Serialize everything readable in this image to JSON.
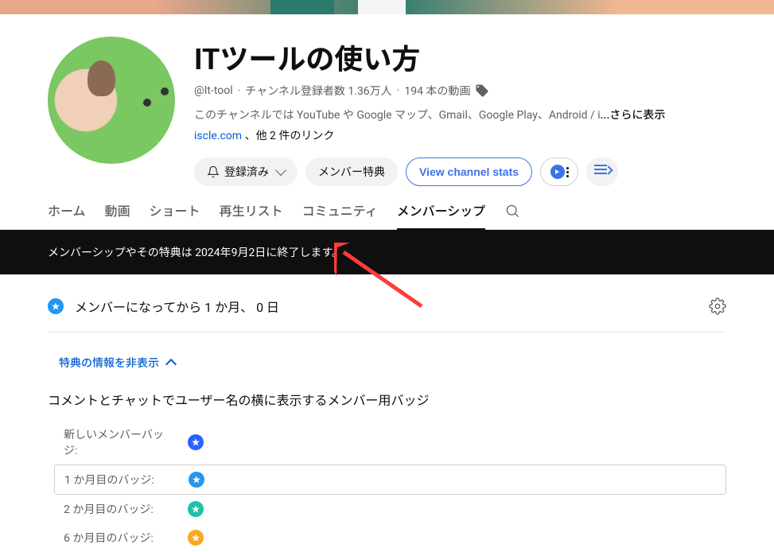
{
  "channel": {
    "name": "ITツールの使い方",
    "handle": "@It-tool",
    "subscribers": "チャンネル登録者数 1.36万人",
    "video_count": "194 本の動画",
    "description": "このチャンネルでは YouTube や  Google マップ、Gmail、Google Play、Android / i",
    "more_label": "...さらに表示",
    "link_primary": "iscle.com",
    "link_others": "、他 2 件のリンク"
  },
  "actions": {
    "subscribed": "登録済み",
    "member_perks": "メンバー特典",
    "view_stats": "View channel stats"
  },
  "tabs": {
    "home": "ホーム",
    "videos": "動画",
    "shorts": "ショート",
    "playlists": "再生リスト",
    "community": "コミュニティ",
    "membership": "メンバーシップ"
  },
  "notice": "メンバーシップやその特典は 2024年9月2日に終了します。",
  "membership_status": "メンバーになってから 1 か月、 0 日",
  "hide_perks_label": "特典の情報を非表示",
  "badge_section_title": "コメントとチャットでユーザー名の横に表示するメンバー用バッジ",
  "badges": [
    {
      "label": "新しいメンバーバッジ:",
      "color": "#2962ff"
    },
    {
      "label": "1 か月目のバッジ:",
      "color": "#2196f3"
    },
    {
      "label": "2 か月目のバッジ:",
      "color": "#1dc1a8"
    },
    {
      "label": "6 か月目のバッジ:",
      "color": "#f9a825"
    }
  ]
}
